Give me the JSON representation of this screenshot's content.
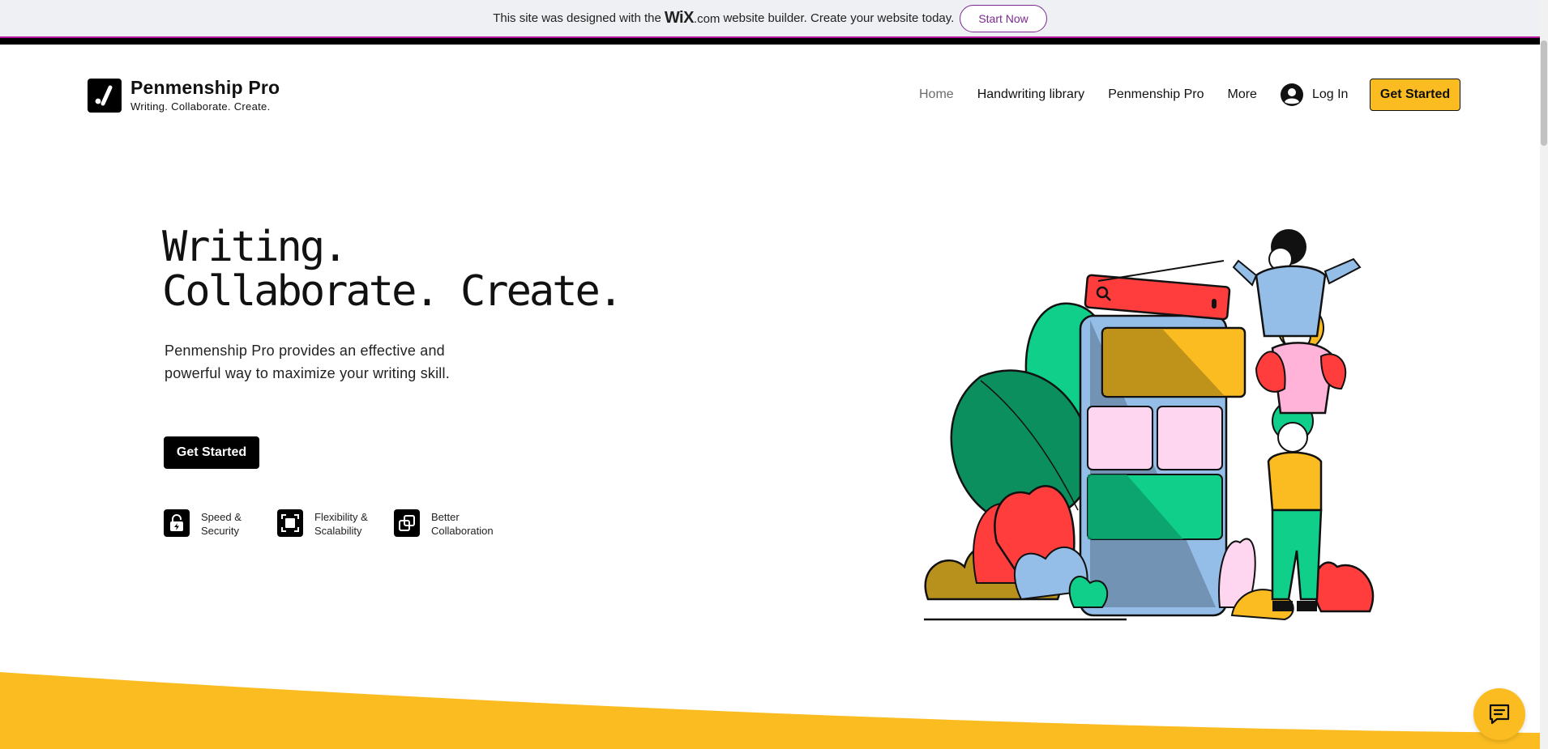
{
  "wix_banner": {
    "prefix": "This site was designed with the",
    "logo_main": "WiX",
    "logo_suffix": ".com",
    "suffix": "website builder. Create your website today.",
    "cta_label": "Start Now"
  },
  "brand": {
    "name": "Penmenship Pro",
    "tagline": "Writing. Collaborate. Create."
  },
  "nav": {
    "items": [
      {
        "label": "Home",
        "active": true
      },
      {
        "label": "Handwriting library",
        "active": false
      },
      {
        "label": "Penmenship Pro",
        "active": false
      },
      {
        "label": "More",
        "active": false
      }
    ],
    "login_label": "Log In",
    "cta_label": "Get Started"
  },
  "hero": {
    "title_line1": "Writing.",
    "title_line2": "Collaborate. Create.",
    "description": "Penmenship Pro provides an effective and powerful way to maximize your writing skill.",
    "cta_label": "Get Started",
    "features": [
      {
        "label": "Speed & Security",
        "icon": "lock-bolt-icon"
      },
      {
        "label": "Flexibility & Scalability",
        "icon": "expand-frame-icon"
      },
      {
        "label": "Better Collaboration",
        "icon": "overlap-squares-icon"
      }
    ]
  },
  "colors": {
    "accent_yellow": "#fbbc21",
    "banner_magenta": "#b3179b",
    "start_now_purple": "#7a2a8c",
    "black": "#000000"
  },
  "icons": {
    "chat": "chat-icon",
    "user": "user-avatar-icon",
    "brand_logo": "pen-check-logo-icon"
  }
}
